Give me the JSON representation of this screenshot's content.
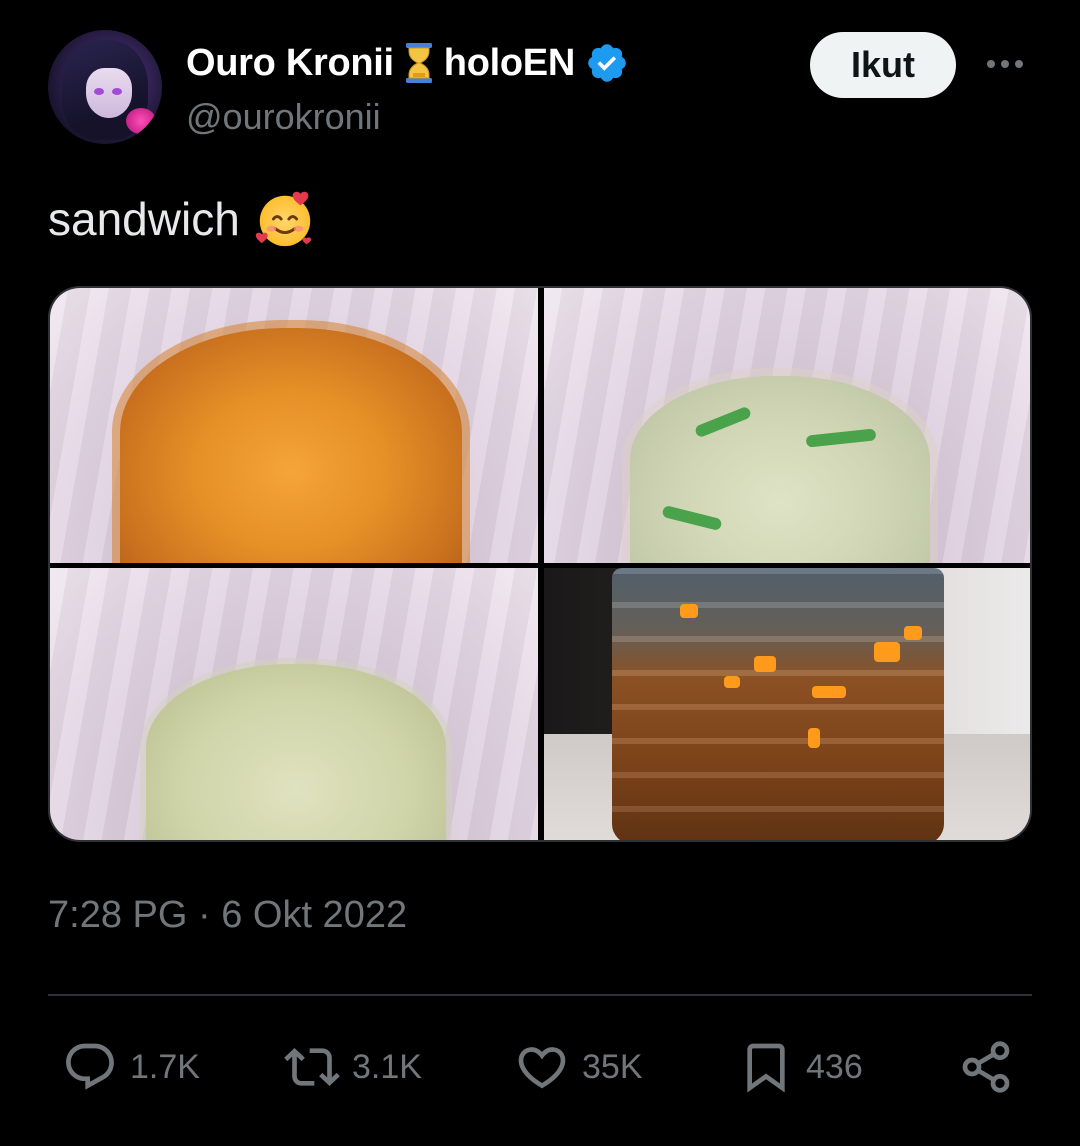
{
  "header": {
    "display_name": "Ouro Kronii",
    "name_suffix": "holoEN",
    "handle": "@ourokronii",
    "follow_label": "Ikut"
  },
  "tweet": {
    "text": "sandwich",
    "emoji_icon": "smiling-face-with-hearts-icon"
  },
  "media": {
    "images": [
      "orange liquid in pink cup",
      "pale liquid with green pieces in pink cup",
      "pale green liquid in pink cup",
      "brown liquid in plastic bottle"
    ]
  },
  "meta": {
    "timestamp": "7:28 PG · 6 Okt 2022"
  },
  "actions": {
    "replies": "1.7K",
    "reposts": "3.1K",
    "likes": "35K",
    "bookmarks": "436"
  },
  "colors": {
    "background": "#000000",
    "text": "#e7e9ea",
    "secondary_text": "#71767b",
    "verified": "#1d9bf0",
    "follow_bg": "#eff3f4"
  }
}
